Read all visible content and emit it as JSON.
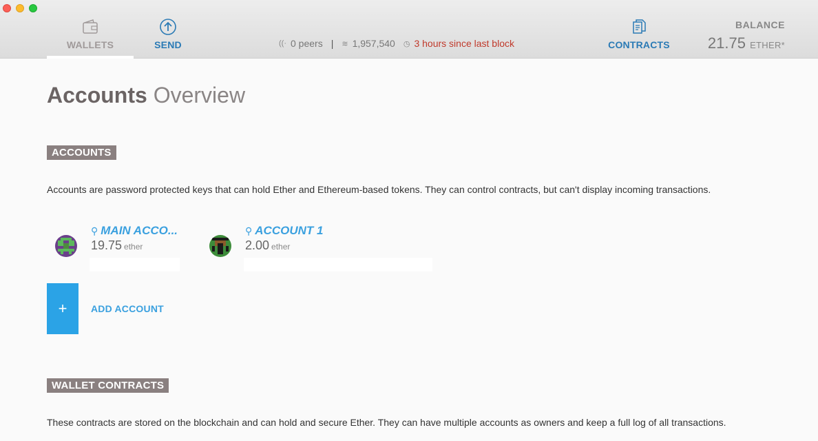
{
  "nav": {
    "wallets_label": "WALLETS",
    "send_label": "SEND",
    "contracts_label": "CONTRACTS"
  },
  "status": {
    "peers": "0 peers",
    "separator": "|",
    "block": "1,957,540",
    "last_block": "3 hours since last block"
  },
  "balance": {
    "label": "BALANCE",
    "value": "21.75",
    "unit": "ETHER*"
  },
  "page": {
    "title_strong": "Accounts",
    "title_light": "Overview"
  },
  "accounts_section": {
    "tag": "ACCOUNTS",
    "description": "Accounts are password protected keys that can hold Ether and Ethereum-based tokens. They can control contracts, but can't display incoming transactions.",
    "items": [
      {
        "name": "MAIN ACCO...",
        "amount": "19.75",
        "unit": "ether"
      },
      {
        "name": "ACCOUNT 1",
        "amount": "2.00",
        "unit": "ether"
      }
    ],
    "add_label": "ADD ACCOUNT",
    "add_symbol": "+"
  },
  "contracts_section": {
    "tag": "WALLET CONTRACTS",
    "description": "These contracts are stored on the blockchain and can hold and secure Ether. They can have multiple accounts as owners and keep a full log of all transactions."
  },
  "colors": {
    "accent": "#2ba3e6",
    "link": "#3aa0df",
    "warning": "#c0392b",
    "section_tag": "#8a8080"
  },
  "icons": {
    "wallets": "wallet-icon",
    "send": "send-arrow-icon",
    "contracts": "contracts-icon",
    "peers": "signal-icon",
    "block": "layers-icon",
    "time": "clock-icon",
    "key": "key-icon"
  }
}
